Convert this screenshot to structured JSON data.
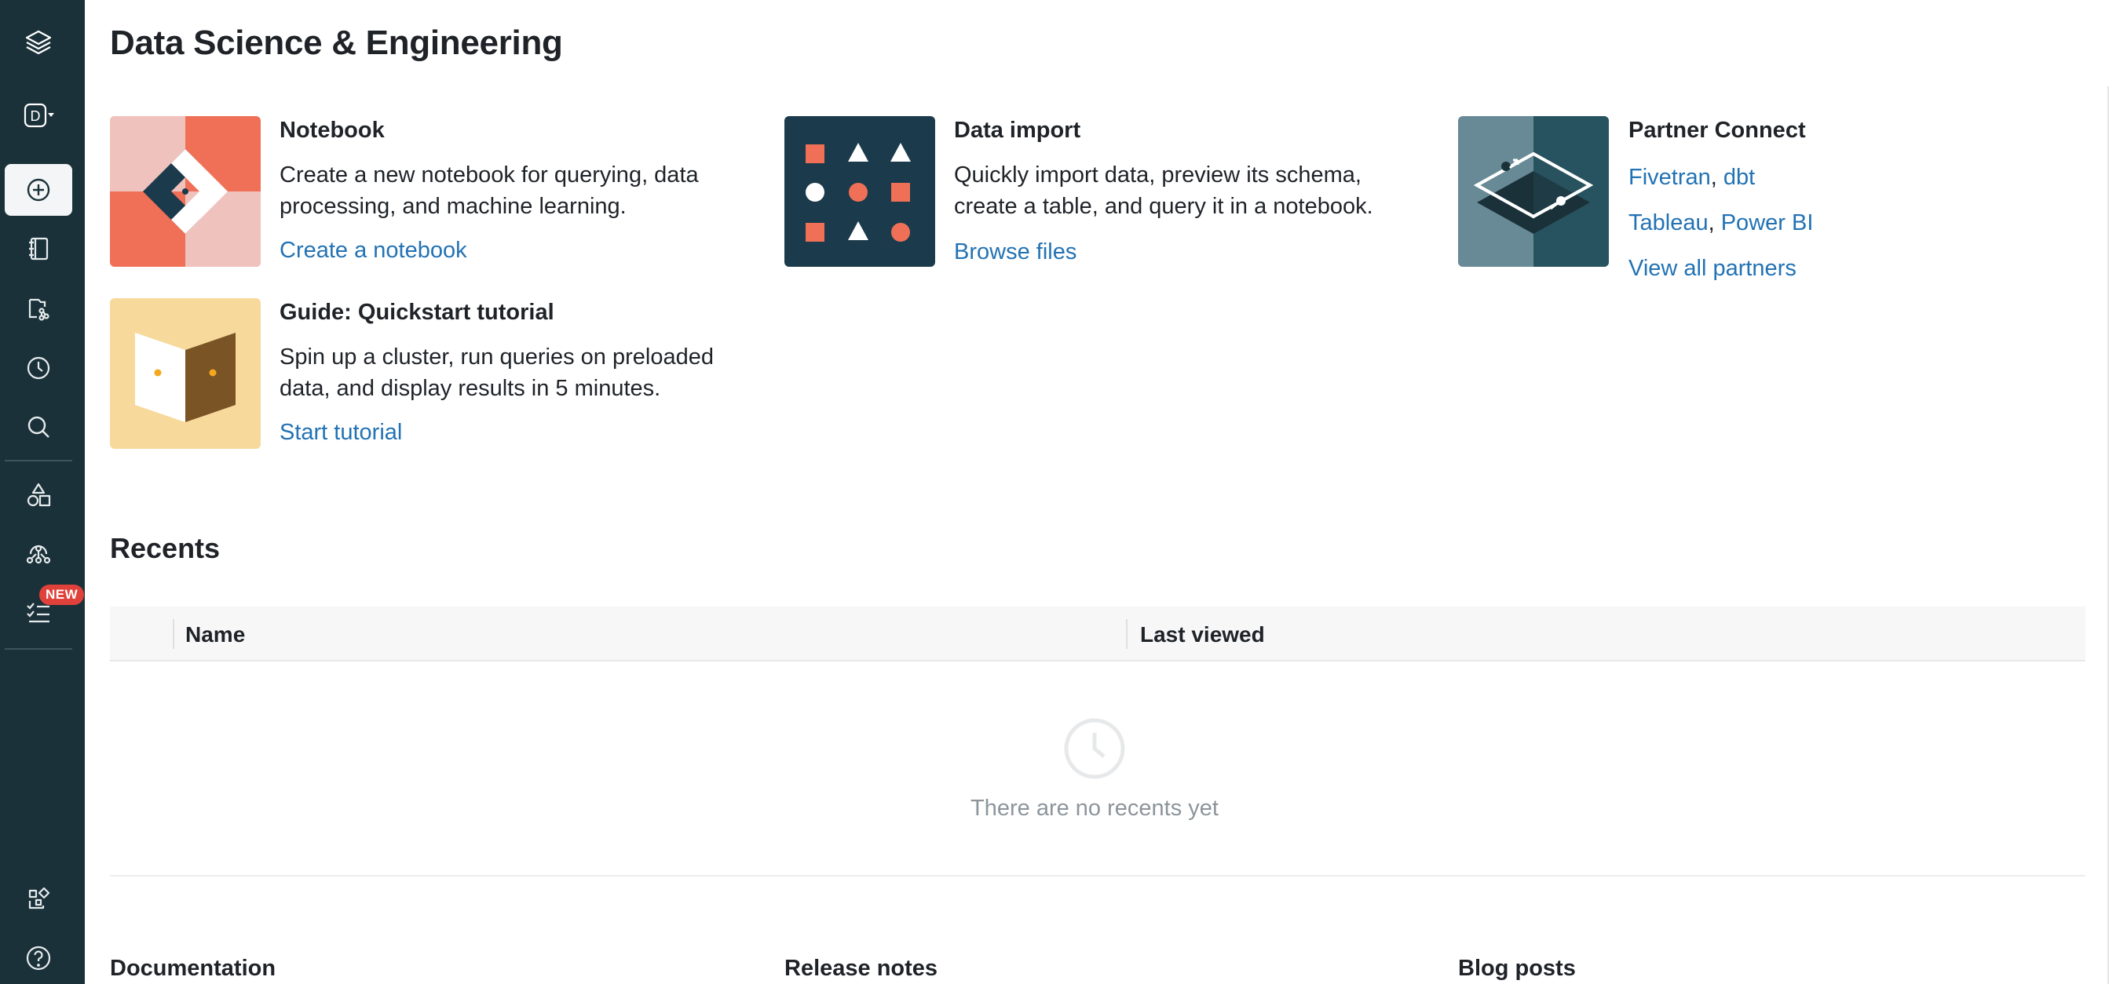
{
  "page": {
    "title": "Data Science & Engineering"
  },
  "sidebar": {
    "persona_letter": "D",
    "badge": "NEW",
    "items": [
      {
        "icon": "layers-logo-icon"
      },
      {
        "icon": "persona-switcher-icon"
      },
      {
        "icon": "create-plus-icon"
      },
      {
        "icon": "workspace-notebook-icon"
      },
      {
        "icon": "repos-icon"
      },
      {
        "icon": "recents-clock-icon"
      },
      {
        "icon": "search-icon"
      },
      {
        "icon": "data-shapes-icon"
      },
      {
        "icon": "compute-cluster-icon"
      },
      {
        "icon": "workflows-list-icon"
      },
      {
        "icon": "marketplace-icon"
      },
      {
        "icon": "help-icon"
      }
    ]
  },
  "cards": {
    "notebook": {
      "title": "Notebook",
      "description": "Create a new notebook for querying, data processing, and machine learning.",
      "link": "Create a notebook"
    },
    "data_import": {
      "title": "Data import",
      "description": "Quickly import data, preview its schema, create a table, and query it in a notebook.",
      "link": "Browse files"
    },
    "partner_connect": {
      "title": "Partner Connect",
      "links_row1": [
        "Fivetran",
        "dbt"
      ],
      "links_row2": [
        "Tableau",
        "Power BI"
      ],
      "separator": ",",
      "link": "View all partners"
    },
    "quickstart": {
      "title": "Guide: Quickstart tutorial",
      "description": "Spin up a cluster, run queries on preloaded data, and display results in 5 minutes.",
      "link": "Start tutorial"
    }
  },
  "recents": {
    "title": "Recents",
    "columns": [
      "Name",
      "Last viewed"
    ],
    "empty_text": "There are no recents yet"
  },
  "footer": {
    "columns": [
      "Documentation",
      "Release notes",
      "Blog posts"
    ]
  },
  "colors": {
    "sidebar_bg": "#1b3139",
    "link": "#2272b4",
    "accent_coral": "#f07057",
    "dark_teal": "#1b3a4b"
  }
}
